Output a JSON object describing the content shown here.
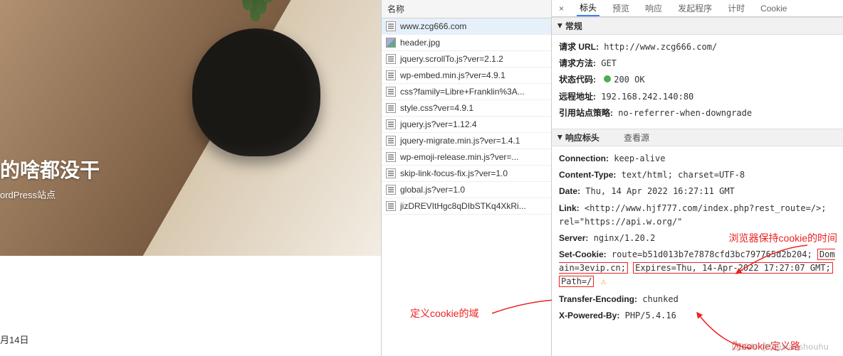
{
  "hero": {
    "title": "的啥都没干",
    "subtitle": "ordPress站点",
    "date": "月14日"
  },
  "mid": {
    "header": "名称",
    "items": [
      "www.zcg666.com",
      "header.jpg",
      "jquery.scrollTo.js?ver=2.1.2",
      "wp-embed.min.js?ver=4.9.1",
      "css?family=Libre+Franklin%3A...",
      "style.css?ver=4.9.1",
      "jquery.js?ver=1.12.4",
      "jquery-migrate.min.js?ver=1.4.1",
      "wp-emoji-release.min.js?ver=...",
      "skip-link-focus-fix.js?ver=1.0",
      "global.js?ver=1.0",
      "jizDREVItHgc8qDIbSTKq4XkRi..."
    ],
    "annotation": "定义cookie的域"
  },
  "tabs": {
    "t0": "×",
    "t1": "标头",
    "t2": "预览",
    "t3": "响应",
    "t4": "发起程序",
    "t5": "计时",
    "t6": "Cookie"
  },
  "general": {
    "header": "常规",
    "url_k": "请求 URL:",
    "url_v": "http://www.zcg666.com/",
    "method_k": "请求方法:",
    "method_v": "GET",
    "status_k": "状态代码:",
    "status_v": "200 OK",
    "remote_k": "远程地址:",
    "remote_v": "192.168.242.140:80",
    "refpol_k": "引用站点策略:",
    "refpol_v": "no-referrer-when-downgrade"
  },
  "resp": {
    "header": "响应标头",
    "viewsrc": "查看源",
    "conn_k": "Connection:",
    "conn_v": "keep-alive",
    "ct_k": "Content-Type:",
    "ct_v": "text/html; charset=UTF-8",
    "date_k": "Date:",
    "date_v": "Thu, 14 Apr 2022 16:27:11 GMT",
    "link_k": "Link:",
    "link_v": "<http://www.hjf777.com/index.php?rest_route=/>; rel=\"https://api.w.org/\"",
    "server_k": "Server:",
    "server_v": "nginx/1.20.2",
    "setcookie_k": "Set-Cookie:",
    "setcookie_prefix": "route=b51d013b7e7878cfd3bc797765d2b204; ",
    "setcookie_domain": "Domain=3evip.cn;",
    "setcookie_expires": "Expires=Thu, 14-Apr-2022 17:27:07 GMT;",
    "setcookie_path": "Path=/",
    "te_k": "Transfer-Encoding:",
    "te_v": "chunked",
    "xp_k": "X-Powered-By:",
    "xp_v": "PHP/5.4.16",
    "ann1": "浏览器保持cookie的时间",
    "ann2": "为cookie定义路"
  },
  "watermark": "CSDN @fajixianshouhu"
}
